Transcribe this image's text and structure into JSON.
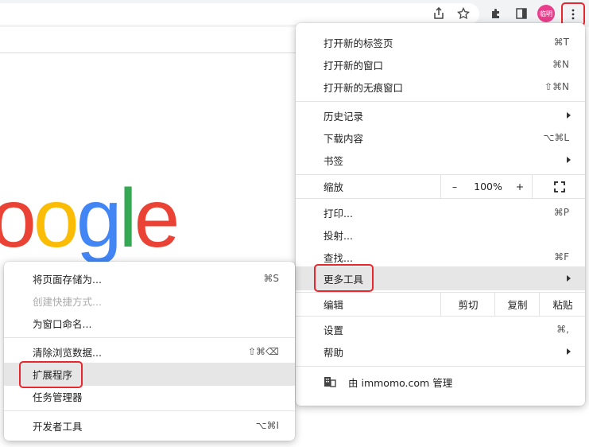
{
  "toolbar": {
    "avatar_text": "临明",
    "icons": [
      "share-icon",
      "star-icon",
      "extensions-icon",
      "side-panel-icon",
      "kebab-menu-icon"
    ]
  },
  "logo": {
    "letters": [
      "o",
      "o",
      "g",
      "l",
      "e"
    ],
    "colors": [
      "#ea4335",
      "#fbbc05",
      "#4285f4",
      "#34a853",
      "#ea4335"
    ]
  },
  "main_menu": {
    "new_tab": {
      "label": "打开新的标签页",
      "shortcut": "⌘T"
    },
    "new_window": {
      "label": "打开新的窗口",
      "shortcut": "⌘N"
    },
    "new_incognito": {
      "label": "打开新的无痕窗口",
      "shortcut": "⇧⌘N"
    },
    "history": {
      "label": "历史记录"
    },
    "downloads": {
      "label": "下载内容",
      "shortcut": "⌥⌘L"
    },
    "bookmarks": {
      "label": "书签"
    },
    "zoom": {
      "label": "缩放",
      "minus": "–",
      "value": "100%",
      "plus": "+"
    },
    "print": {
      "label": "打印...",
      "shortcut": "⌘P"
    },
    "cast": {
      "label": "投射..."
    },
    "find": {
      "label": "查找...",
      "shortcut": "⌘F"
    },
    "more_tools": {
      "label": "更多工具"
    },
    "edit": {
      "label": "编辑",
      "cut": "剪切",
      "copy": "复制",
      "paste": "粘贴"
    },
    "settings": {
      "label": "设置",
      "shortcut": "⌘,"
    },
    "help": {
      "label": "帮助"
    },
    "managed": {
      "label": "由 immomo.com 管理"
    }
  },
  "sub_menu": {
    "save_page": {
      "label": "将页面存储为...",
      "shortcut": "⌘S"
    },
    "create_shortcut": {
      "label": "创建快捷方式..."
    },
    "name_window": {
      "label": "为窗口命名..."
    },
    "clear_data": {
      "label": "清除浏览数据...",
      "shortcut": "⇧⌘⌫"
    },
    "extensions": {
      "label": "扩展程序"
    },
    "task_manager": {
      "label": "任务管理器"
    },
    "dev_tools": {
      "label": "开发者工具",
      "shortcut": "⌥⌘I"
    }
  },
  "colors": {
    "highlight_border": "#e8262d",
    "hover_bg": "#e6e6e6"
  }
}
